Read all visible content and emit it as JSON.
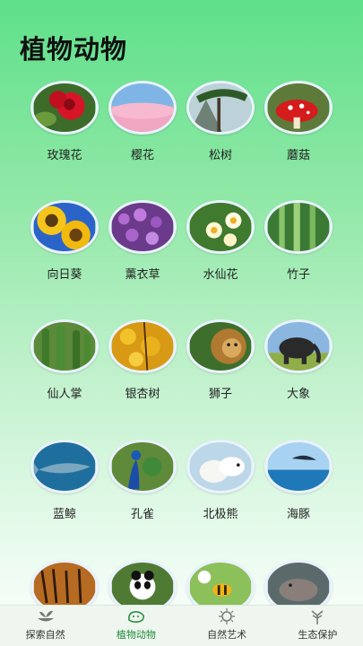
{
  "page": {
    "title": "植物动物"
  },
  "items": [
    {
      "label": "玫瑰花"
    },
    {
      "label": "樱花"
    },
    {
      "label": "松树"
    },
    {
      "label": "蘑菇"
    },
    {
      "label": "向日葵"
    },
    {
      "label": "薰衣草"
    },
    {
      "label": "水仙花"
    },
    {
      "label": "竹子"
    },
    {
      "label": "仙人掌"
    },
    {
      "label": "银杏树"
    },
    {
      "label": "狮子"
    },
    {
      "label": "大象"
    },
    {
      "label": "蓝鲸"
    },
    {
      "label": "孔雀"
    },
    {
      "label": "北极熊"
    },
    {
      "label": "海豚"
    },
    {
      "label": ""
    },
    {
      "label": ""
    },
    {
      "label": ""
    },
    {
      "label": ""
    }
  ],
  "tabs": [
    {
      "label": "探索自然"
    },
    {
      "label": "植物动物"
    },
    {
      "label": "自然艺术"
    },
    {
      "label": "生态保护"
    }
  ]
}
